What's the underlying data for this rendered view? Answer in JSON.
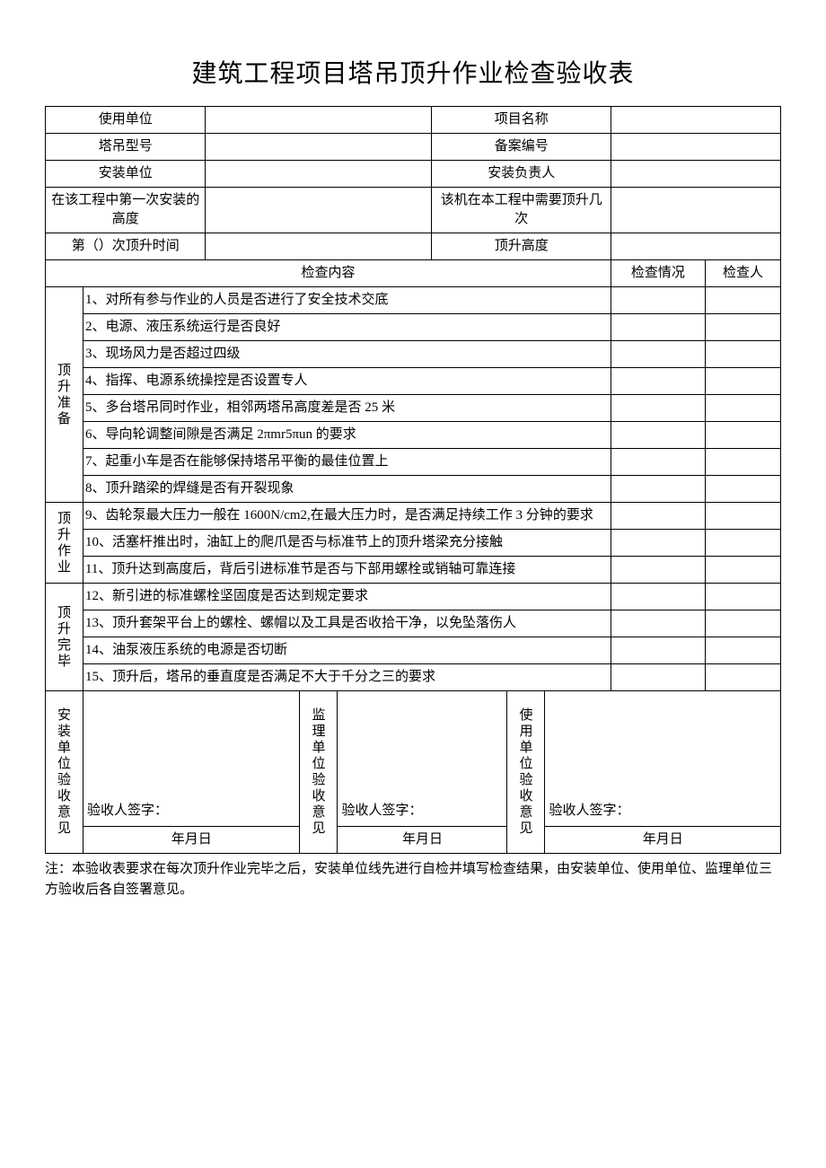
{
  "title": "建筑工程项目塔吊顶升作业检查验收表",
  "header": {
    "use_unit": "使用单位",
    "project_name": "项目名称",
    "crane_model": "塔吊型号",
    "record_no": "备案编号",
    "install_unit": "安装单位",
    "install_head": "安装负责人",
    "first_height": "在该工程中第一次安装的高度",
    "need_times": "该机在本工程中需要顶升几次",
    "nth_time": "第（）次顶升时间",
    "lift_height": "顶升高度"
  },
  "cols": {
    "content": "检查内容",
    "status": "检查情况",
    "checker": "检查人"
  },
  "groups": {
    "prep": "顶升准备",
    "work": "顶升作业",
    "done": "顶升完毕"
  },
  "items": {
    "i1": "1、对所有参与作业的人员是否进行了安全技术交底",
    "i2": "2、电源、液压系统运行是否良好",
    "i3": "3、现场风力是否超过四级",
    "i4": "4、指挥、电源系统操控是否设置专人",
    "i5": "5、多台塔吊同时作业，相邻两塔吊高度差是否 25 米",
    "i6": "6、导向轮调整间隙是否满足 2πmr5πun 的要求",
    "i7": "7、起重小车是否在能够保持塔吊平衡的最佳位置上",
    "i8": "8、顶升踏梁的焊缝是否有开裂现象",
    "i9": "9、齿轮泵最大压力一般在 1600N/cm2,在最大压力时，是否满足持续工作 3 分钟的要求",
    "i10": "10、活塞杆推出时，油缸上的爬爪是否与标准节上的顶升塔梁充分接触",
    "i11": "11、顶升达到高度后，背后引进标准节是否与下部用螺栓或销轴可靠连接",
    "i12": "12、新引进的标准螺栓坚固度是否达到规定要求",
    "i13": "13、顶升套架平台上的螺栓、螺帽以及工具是否收拾干净，以免坠落伤人",
    "i14": "14、油泵液压系统的电源是否切断",
    "i15": "15、顶升后，塔吊的垂直度是否满足不大于千分之三的要求"
  },
  "sign": {
    "install_op": "安装单位验收意见",
    "supervise_op": "监理单位验收意见",
    "use_op": "使用单位验收意见",
    "sig": "验收人签字：",
    "date": "年月日"
  },
  "note": "注：本验收表要求在每次顶升作业完毕之后，安装单位线先进行自检并填写检查结果，由安装单位、使用单位、监理单位三方验收后各自签署意见。"
}
